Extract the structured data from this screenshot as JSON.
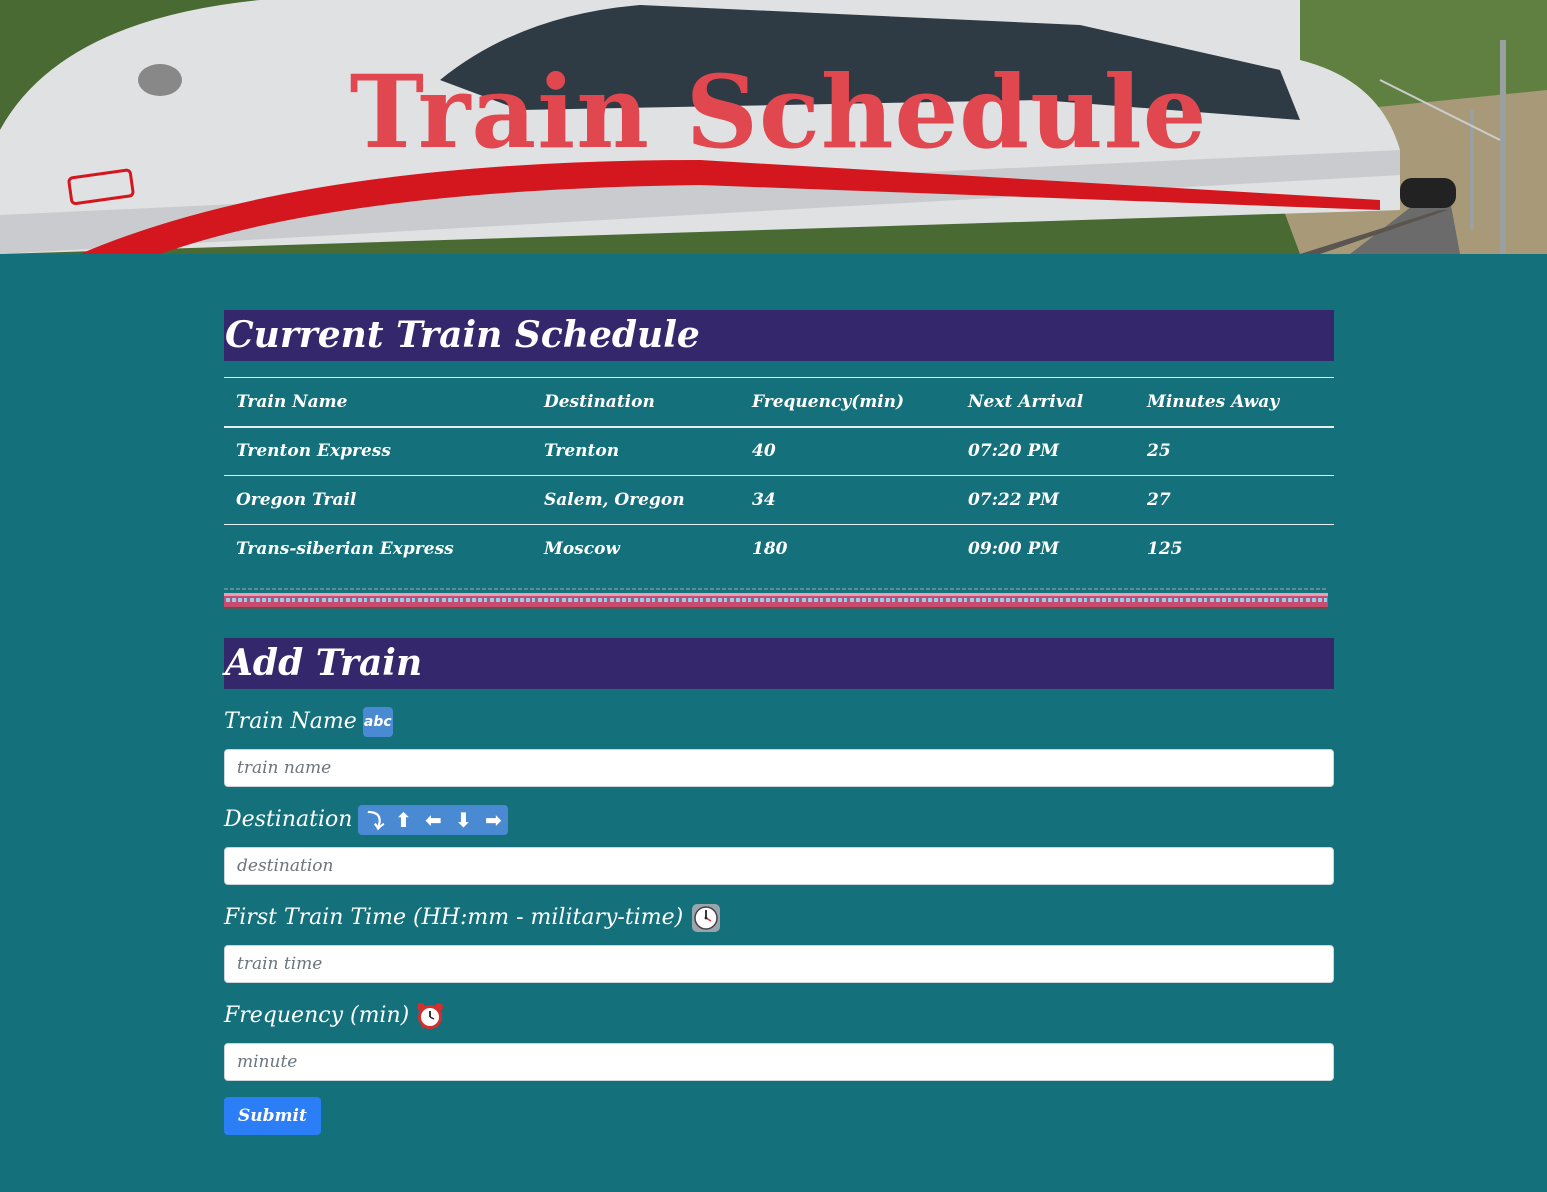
{
  "hero": {
    "title": "Train Schedule",
    "title_color": "#e0474f"
  },
  "schedule": {
    "heading": "Current Train Schedule",
    "columns": [
      "Train Name",
      "Destination",
      "Frequency(min)",
      "Next Arrival",
      "Minutes Away"
    ],
    "rows": [
      [
        "Trenton Express",
        "Trenton",
        "40",
        "07:20 PM",
        "25"
      ],
      [
        "Oregon Trail",
        "Salem, Oregon",
        "34",
        "07:22 PM",
        "27"
      ],
      [
        "Trans-siberian Express",
        "Moscow",
        "180",
        "09:00 PM",
        "125"
      ]
    ]
  },
  "add_train": {
    "heading": "Add Train",
    "fields": [
      {
        "label": "Train Name",
        "icon": "abc-icon",
        "placeholder": "train name"
      },
      {
        "label": "Destination",
        "icon": "arrows-icon",
        "placeholder": "destination"
      },
      {
        "label": "First Train Time (HH:mm - military-time)",
        "icon": "clock-icon",
        "placeholder": "train time"
      },
      {
        "label": "Frequency (min)",
        "icon": "alarm-clock-icon",
        "placeholder": "minute"
      }
    ],
    "abc_glyph": "abc",
    "arrow_glyphs": [
      "⤵",
      "⬆",
      "⬅",
      "⬇",
      "➡"
    ],
    "submit_label": "Submit"
  },
  "colors": {
    "background": "#14707a",
    "section_header": "#35276b",
    "submit": "#2b7ef6",
    "emoji_box": "#4a8ad3"
  }
}
